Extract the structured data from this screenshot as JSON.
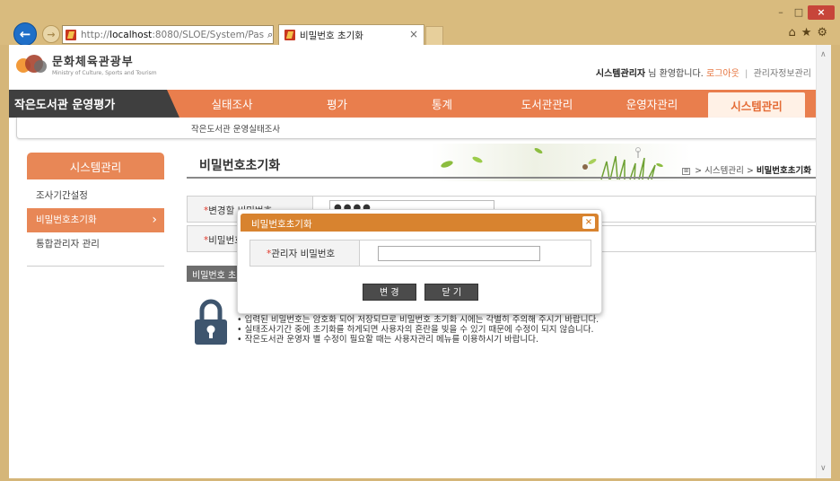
{
  "browser": {
    "url_prefix": "http://",
    "url_host": "localhost",
    "url_rest": ":8080/SLOE/System/Pas",
    "address_icons": "⌕ ▾ ↻",
    "tab_title": "비밀번호 초기화",
    "tab_close": "×",
    "win_minimize": "–",
    "win_maximize": "□",
    "win_close": "×",
    "toolbar_icons": "⌂★⚙",
    "back": "←",
    "forward": "→"
  },
  "site": {
    "logo_title": "문화체육관광부",
    "logo_sub": "Ministry of Culture, Sports and Tourism",
    "user_name": "시스템관리자",
    "welcome": " 님 환영합니다.",
    "logout": "로그아웃",
    "separator": "|",
    "account_info": "관리자정보관리"
  },
  "nav": {
    "home": "작은도서관 운영평가",
    "items": [
      "실태조사",
      "평가",
      "통계",
      "도서관관리",
      "운영자관리",
      "시스템관리"
    ],
    "active_index": 5
  },
  "subnav": {
    "label": "작은도서관 운영실태조사"
  },
  "sidebar": {
    "title": "시스템관리",
    "items": [
      "조사기간설정",
      "비밀번호초기화",
      "통합관리자 관리"
    ],
    "active_index": 1
  },
  "content": {
    "title": "비밀번호초기화",
    "breadcrumb_icon": "⊞",
    "breadcrumb_parent": " > 시스템관리 > ",
    "breadcrumb_current": "비밀번호초기화",
    "rows": [
      {
        "required": "*",
        "label": "변경할 비밀번호",
        "value": "●●●●"
      },
      {
        "required": "*",
        "label": "비밀번호 확인",
        "value": ""
      }
    ],
    "section_tag": "비밀번호 초기화 안내",
    "notes": [
      "입력된 비밀번호는 암호화 되어 저장되므로 비밀번호 초기화 시에는 각별히 주의해 주시기 바랍니다.",
      "실태조사기간 중에 초기화를 하게되면 사용자의 혼란을 빚을 수 있기 때문에 수정이 되지 않습니다.",
      "작은도서관 운영자 별 수정이 필요할 때는 사용자관리 메뉴를 이용하시기 바랍니다."
    ]
  },
  "modal": {
    "title": "비밀번호초기화",
    "close": "×",
    "required": "*",
    "field_label": "관리자 비밀번호",
    "field_value": "",
    "submit": "변 경",
    "cancel": "닫 기"
  },
  "colors": {
    "nav_bg": "#e97e4d",
    "modal_header": "#d8832f",
    "accent": "#e88756",
    "required": "#e03a2c"
  }
}
